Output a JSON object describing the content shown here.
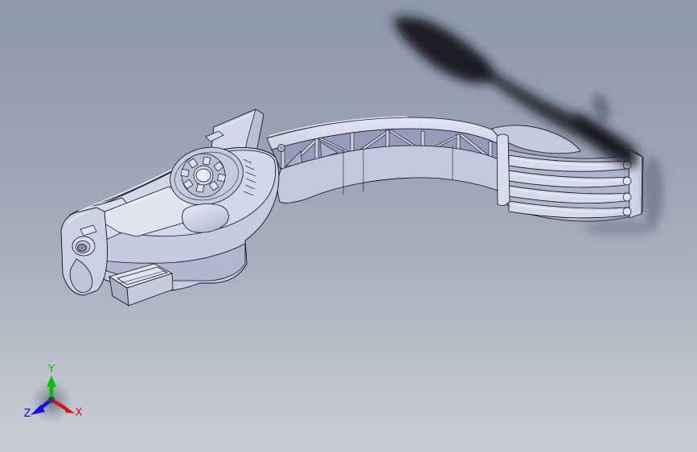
{
  "scene": {
    "background_top_color": "#8d99ac",
    "background_bottom_color": "#c8ccd5",
    "model_body_color": "#c8cee1",
    "model_light_face_color": "#dde1f0",
    "model_dark_face_color": "#aab1c9",
    "model_edge_color": "#0e0e16",
    "shadow_artifact_color": "#15171c"
  },
  "axis_triad": {
    "x_label": "X",
    "x_color": "#d81414",
    "y_label": "Y",
    "y_color": "#00c400",
    "z_label": "Z",
    "z_color": "#1313e8"
  }
}
